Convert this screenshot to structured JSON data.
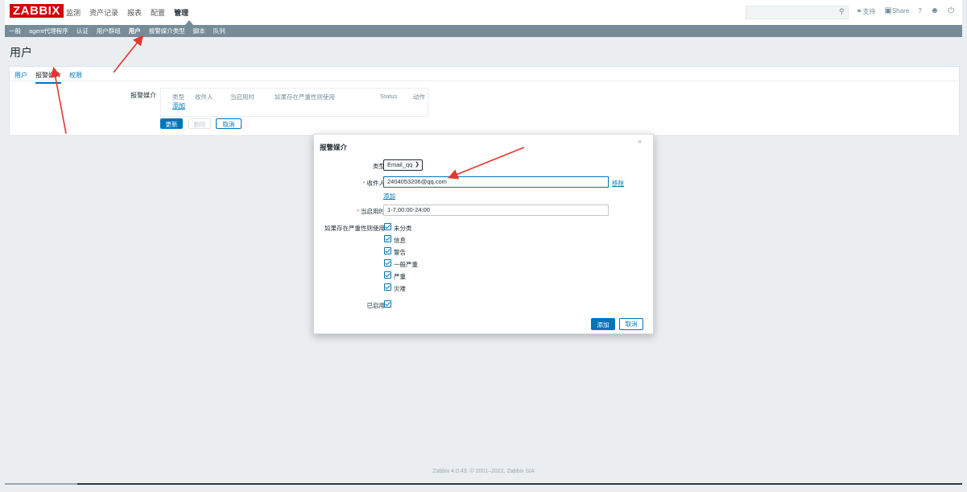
{
  "header": {
    "logo": "ZABBIX",
    "menu": [
      "监测",
      "资产记录",
      "报表",
      "配置",
      "管理"
    ],
    "active_menu": "管理",
    "right": {
      "support": "支持",
      "share": "Share",
      "help": "?"
    }
  },
  "submenu": [
    "一般",
    "agent代理程序",
    "认证",
    "用户群组",
    "用户",
    "报警媒介类型",
    "脚本",
    "队列"
  ],
  "page_title": "用户",
  "tabs": [
    "用户",
    "报警媒介",
    "权限"
  ],
  "media_section": {
    "label": "报警媒介",
    "columns": [
      "类型",
      "收件人",
      "当启用时",
      "如果存在严重性则使用",
      "Status",
      "动作"
    ],
    "add_link": "添加",
    "buttons": {
      "update": "更新",
      "delete": "删除",
      "cancel": "取消"
    }
  },
  "modal": {
    "title": "报警媒介",
    "close": "×",
    "type_label": "类型",
    "type_value": "Email_qq",
    "recipient_label": "收件人",
    "recipient_value": "2404053206@qq.com",
    "remove_link": "移除",
    "add_link": "添加",
    "when_active_label": "当启用时",
    "when_active_value": "1-7,00:00-24:00",
    "severity_label": "如果存在严重性则使用",
    "severities": [
      "未分类",
      "信息",
      "警告",
      "一般严重",
      "严重",
      "灾难"
    ],
    "enabled_label": "已启用",
    "buttons": {
      "add": "添加",
      "cancel": "取消"
    }
  },
  "footer": "Zabbix 4.0.43. © 2001–2022, Zabbix SIA",
  "colors": {
    "accent": "#0275b8",
    "submenu_bg": "#768d99",
    "logo_red": "#d40000",
    "arrow": "#e8352e"
  }
}
